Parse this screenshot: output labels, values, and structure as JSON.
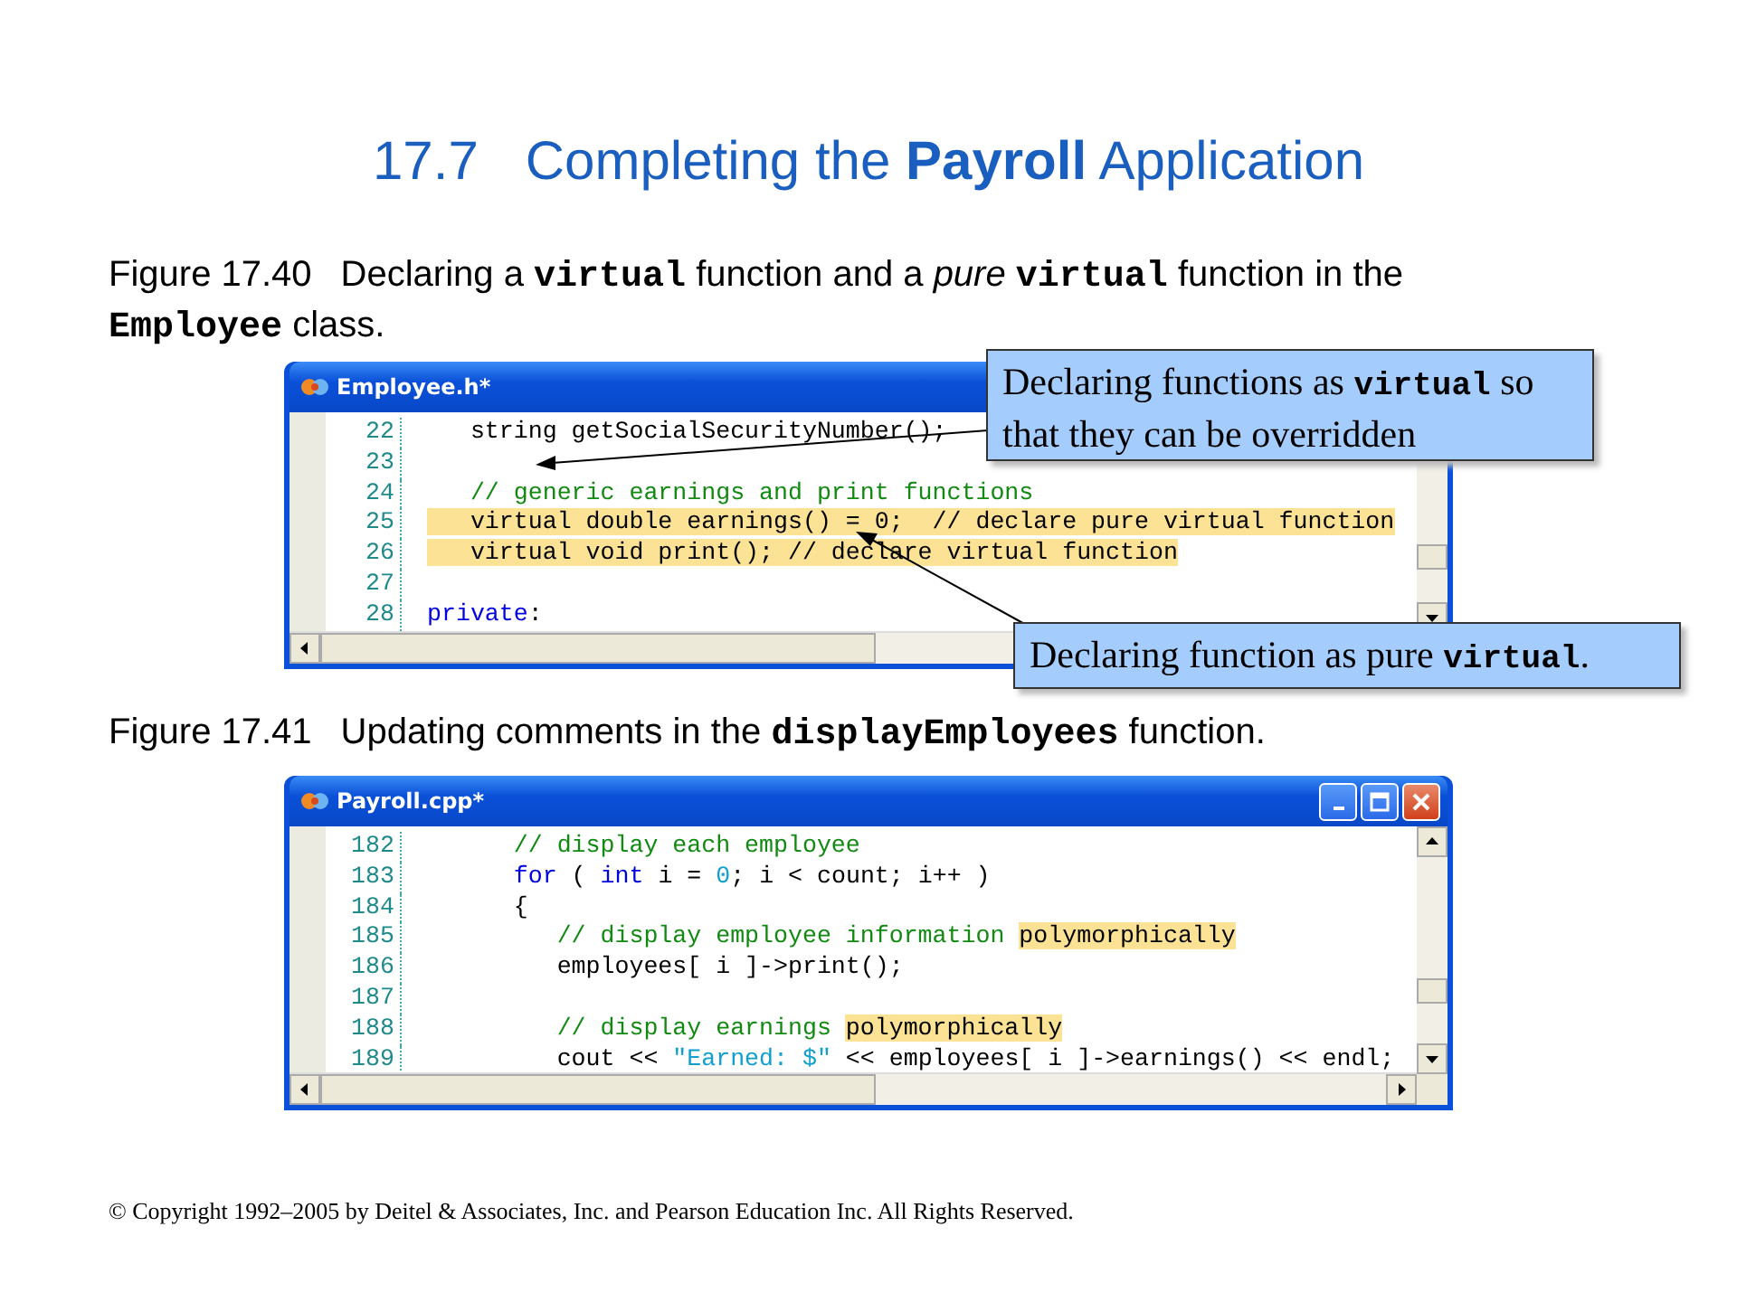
{
  "slide": {
    "section_number": "17.7",
    "title": "Completing the **Payroll** Application"
  },
  "figures": [
    {
      "caption_number": "Figure 17.40",
      "caption": "Declaring a **virtual** function and a *pure* **virtual** function in the **Employee** class.",
      "window": {
        "title": "Employee.h*",
        "lines": [
          {
            "number": "22",
            "segments": [
              {
                "text": "   string getSocialSecurityNumber();",
                "kind": "plain",
                "highlighted": false
              }
            ]
          },
          {
            "number": "23"
          },
          {
            "number": "24",
            "segments": [
              {
                "text": "   // generic earnings and print functions",
                "kind": "comment",
                "highlighted": false
              }
            ]
          },
          {
            "number": "25",
            "segments": [
              {
                "text": "   virtual double earnings() = 0;  // declare pure virtual function",
                "kind": "plain",
                "highlighted": true
              }
            ]
          },
          {
            "number": "26",
            "segments": [
              {
                "text": "   virtual void print(); // declare virtual function",
                "kind": "plain",
                "highlighted": true
              }
            ]
          },
          {
            "number": "27"
          },
          {
            "number": "28",
            "segments": [
              {
                "text": "private",
                "kind": "keyword",
                "highlighted": false
              },
              {
                "text": ":",
                "kind": "plain",
                "highlighted": false
              }
            ]
          }
        ]
      }
    },
    {
      "caption_number": "Figure 17.41",
      "caption": "Updating comments in the **displayEmployees** function.",
      "window": {
        "title": "Payroll.cpp*",
        "title_buttons": true,
        "lines": [
          {
            "number": "182",
            "segments": [
              {
                "text": "      // display each employee",
                "kind": "comment",
                "highlighted": false
              }
            ]
          },
          {
            "number": "183",
            "segments": [
              {
                "text": "      for",
                "kind": "keyword",
                "highlighted": false
              },
              {
                "text": " ( ",
                "kind": "plain",
                "highlighted": false
              },
              {
                "text": "int",
                "kind": "keyword",
                "highlighted": false
              },
              {
                "text": " i = ",
                "kind": "plain",
                "highlighted": false
              },
              {
                "text": "0",
                "kind": "literal",
                "highlighted": false
              },
              {
                "text": "; i < count; i++ )",
                "kind": "plain",
                "highlighted": false
              }
            ]
          },
          {
            "number": "184",
            "segments": [
              {
                "text": "      {",
                "kind": "plain",
                "highlighted": false
              }
            ]
          },
          {
            "number": "185",
            "segments": [
              {
                "text": "         // display employee information ",
                "kind": "comment",
                "highlighted": false
              },
              {
                "text": "polymorphically",
                "kind": "plain",
                "highlighted": true
              }
            ]
          },
          {
            "number": "186",
            "segments": [
              {
                "text": "         employees[ i ]->print();",
                "kind": "plain",
                "highlighted": false
              }
            ]
          },
          {
            "number": "187"
          },
          {
            "number": "188",
            "segments": [
              {
                "text": "         // display earnings ",
                "kind": "comment",
                "highlighted": false
              },
              {
                "text": "polymorphically",
                "kind": "plain",
                "highlighted": true
              }
            ]
          },
          {
            "number": "189",
            "segments": [
              {
                "text": "         cout << ",
                "kind": "plain",
                "highlighted": false
              },
              {
                "text": "\"Earned: $\"",
                "kind": "literal",
                "highlighted": false
              },
              {
                "text": " << employees[ i ]->earnings() << endl;",
                "kind": "plain",
                "highlighted": false
              }
            ]
          }
        ]
      }
    }
  ],
  "callouts": [
    {
      "text": "Declaring functions as **virtual** so that they can be overridden"
    },
    {
      "text": "Declaring function as pure **virtual**."
    }
  ],
  "copyright": "© Copyright 1992–2005 by Deitel & Associates, Inc. and Pearson Education Inc. All Rights Reserved."
}
